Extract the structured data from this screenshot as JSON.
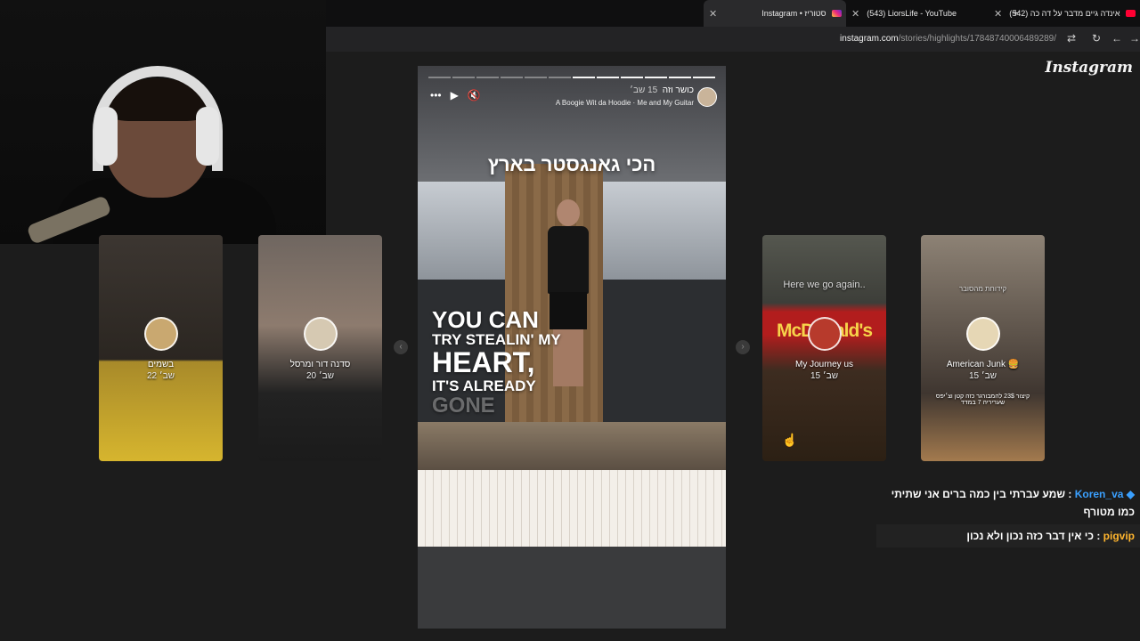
{
  "browser": {
    "tabs": [
      {
        "title": "Instagram • סטוריז",
        "favicon": "instagram-icon",
        "active": true
      },
      {
        "title": "(543) LiorsLife - YouTube",
        "favicon": "youtube-icon",
        "active": false
      },
      {
        "title": "(542) אינדה גיים מדבר על דה כה",
        "favicon": "youtube-icon",
        "active": false
      }
    ],
    "url_domain": "instagram.com",
    "url_path": "/stories/highlights/17848740006489289/"
  },
  "brand": {
    "logo": "Instagram"
  },
  "side_stories": [
    {
      "name": "בשמים",
      "age": "22 שב׳",
      "overlay": ""
    },
    {
      "name": "סדנה דור ומרסל",
      "age": "20 שב׳",
      "overlay": ""
    },
    {
      "name": "My Journey us",
      "age": "15 שב׳",
      "overlay": "Here we go again..",
      "sign": "McDonald's"
    },
    {
      "name": "American Junk 🍔",
      "age": "15 שב׳",
      "overlay": "קידוחת מהסובר",
      "caption": "קיצור 23$ להמבורגר כזה קטן וצ׳יפס שעריריה 7 במדד"
    }
  ],
  "main_story": {
    "user": "כושר וזה",
    "age": "15 שב׳",
    "song": "A Boogie Wit da Hoodie · Me and My Guitar",
    "headline": "הכי גאנגסטר בארץ",
    "quote": [
      "YOU CAN",
      "TRY STEALIN' MY",
      "HEART,",
      "IT'S ALREADY",
      "GONE"
    ],
    "progress_total": 12,
    "progress_done": 6
  },
  "chat": [
    {
      "user": "Koren_va",
      "text": "שמע עברתי בין כמה ברים אני שתיתי כמו מטורף",
      "user_color": "#3aa0ff"
    },
    {
      "user": "pigvip",
      "text": "כי אין דבר כזה נכון ולא נכון",
      "user_color": "#ffb52e"
    }
  ]
}
